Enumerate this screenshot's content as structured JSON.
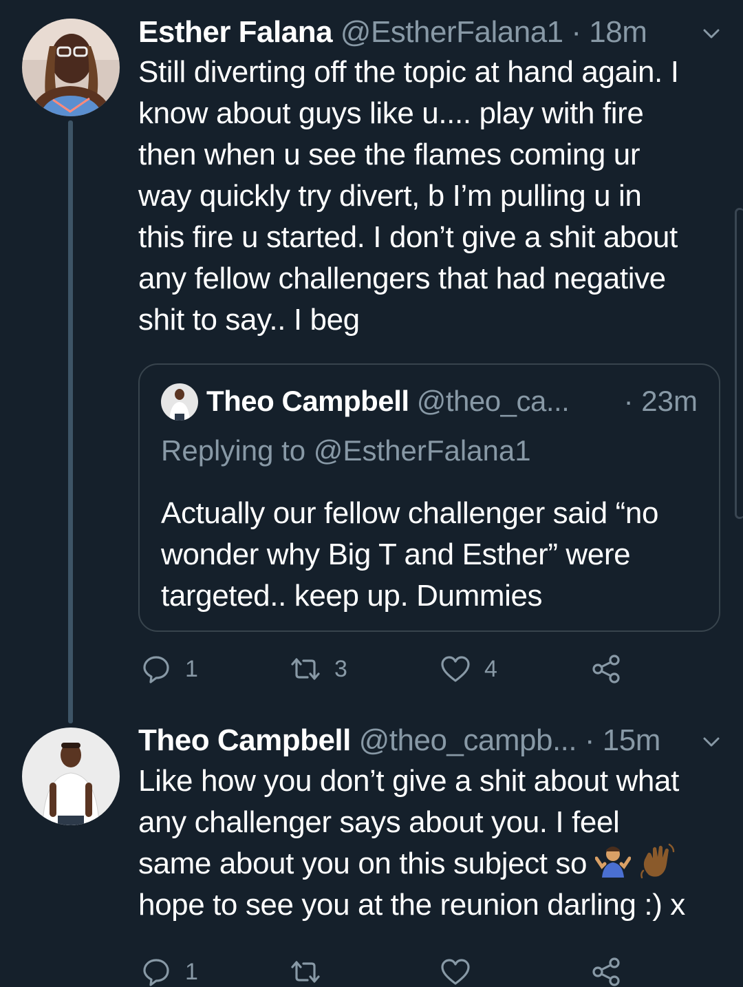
{
  "tweets": [
    {
      "name": "Esther Falana",
      "handle": "@EstherFalana1",
      "separator": "·",
      "time": "18m",
      "lines": [
        "Still diverting off the topic at hand again. I",
        "know about guys like u.... play with fire",
        "then when u see the flames coming ur",
        "way quickly try divert, b I’m pulling u in",
        "this fire u started. I don’t give a shit about",
        "any fellow challengers that had negative",
        "shit to say.. I beg"
      ],
      "quote": {
        "name": "Theo Campbell",
        "handle": "@theo_ca...",
        "time": "· 23m",
        "replying_to": "Replying to @EstherFalana1",
        "lines": [
          "Actually our fellow challenger said “no",
          "wonder why Big T and Esther” were",
          "targeted.. keep up. Dummies"
        ]
      },
      "actions": {
        "replies": "1",
        "retweets": "3",
        "likes": "4"
      }
    },
    {
      "name": "Theo Campbell",
      "handle": "@theo_campb...",
      "separator": "·",
      "time": "15m",
      "lines": [
        "Like how you don’t give a shit about what",
        "any challenger says about you. I feel",
        "same about you on this subject so",
        "hope to see you at the reunion darling :) x"
      ],
      "emojis": [
        "person-shrugging-emoji",
        "waving-hand-emoji"
      ],
      "actions": {
        "replies": "1",
        "retweets": "",
        "likes": ""
      }
    }
  ],
  "colors": {
    "background": "#15202b",
    "secondary_text": "#8899a6",
    "border": "#38444d",
    "thread_line": "#3d5466"
  }
}
